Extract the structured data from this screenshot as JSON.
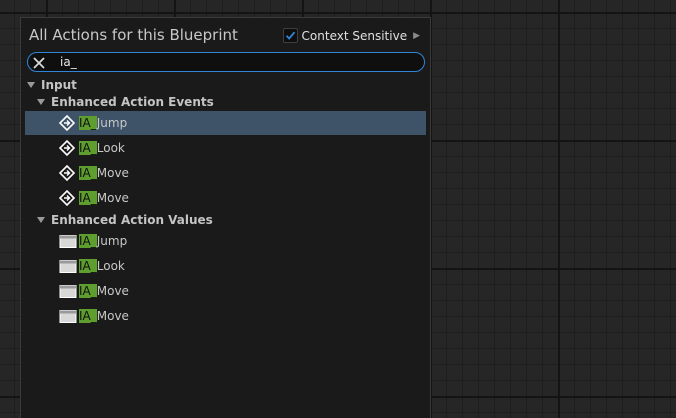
{
  "panel": {
    "title": "All Actions for this Blueprint",
    "context_sensitive_label": "Context Sensitive",
    "context_sensitive_checked": true
  },
  "search": {
    "value": "ia_"
  },
  "tree": {
    "root": {
      "label": "Input"
    },
    "groups": [
      {
        "label": "Enhanced Action Events",
        "icon": "event-diamond-icon",
        "items": [
          {
            "prefix": "IA_",
            "rest": "Jump",
            "selected": true
          },
          {
            "prefix": "IA_",
            "rest": "Look"
          },
          {
            "prefix": "IA_",
            "rest": "Move"
          },
          {
            "prefix": "IA_",
            "rest": "Move"
          }
        ]
      },
      {
        "label": "Enhanced Action Values",
        "icon": "value-box-icon",
        "items": [
          {
            "prefix": "IA_",
            "rest": "Jump"
          },
          {
            "prefix": "IA_",
            "rest": "Look"
          },
          {
            "prefix": "IA_",
            "rest": "Move"
          },
          {
            "prefix": "IA_",
            "rest": "Move"
          }
        ]
      }
    ]
  },
  "colors": {
    "highlight": "#5e9e2f",
    "selection": "#3e5268",
    "search_border": "#2f86d8",
    "checkmark": "#2f86d8"
  }
}
